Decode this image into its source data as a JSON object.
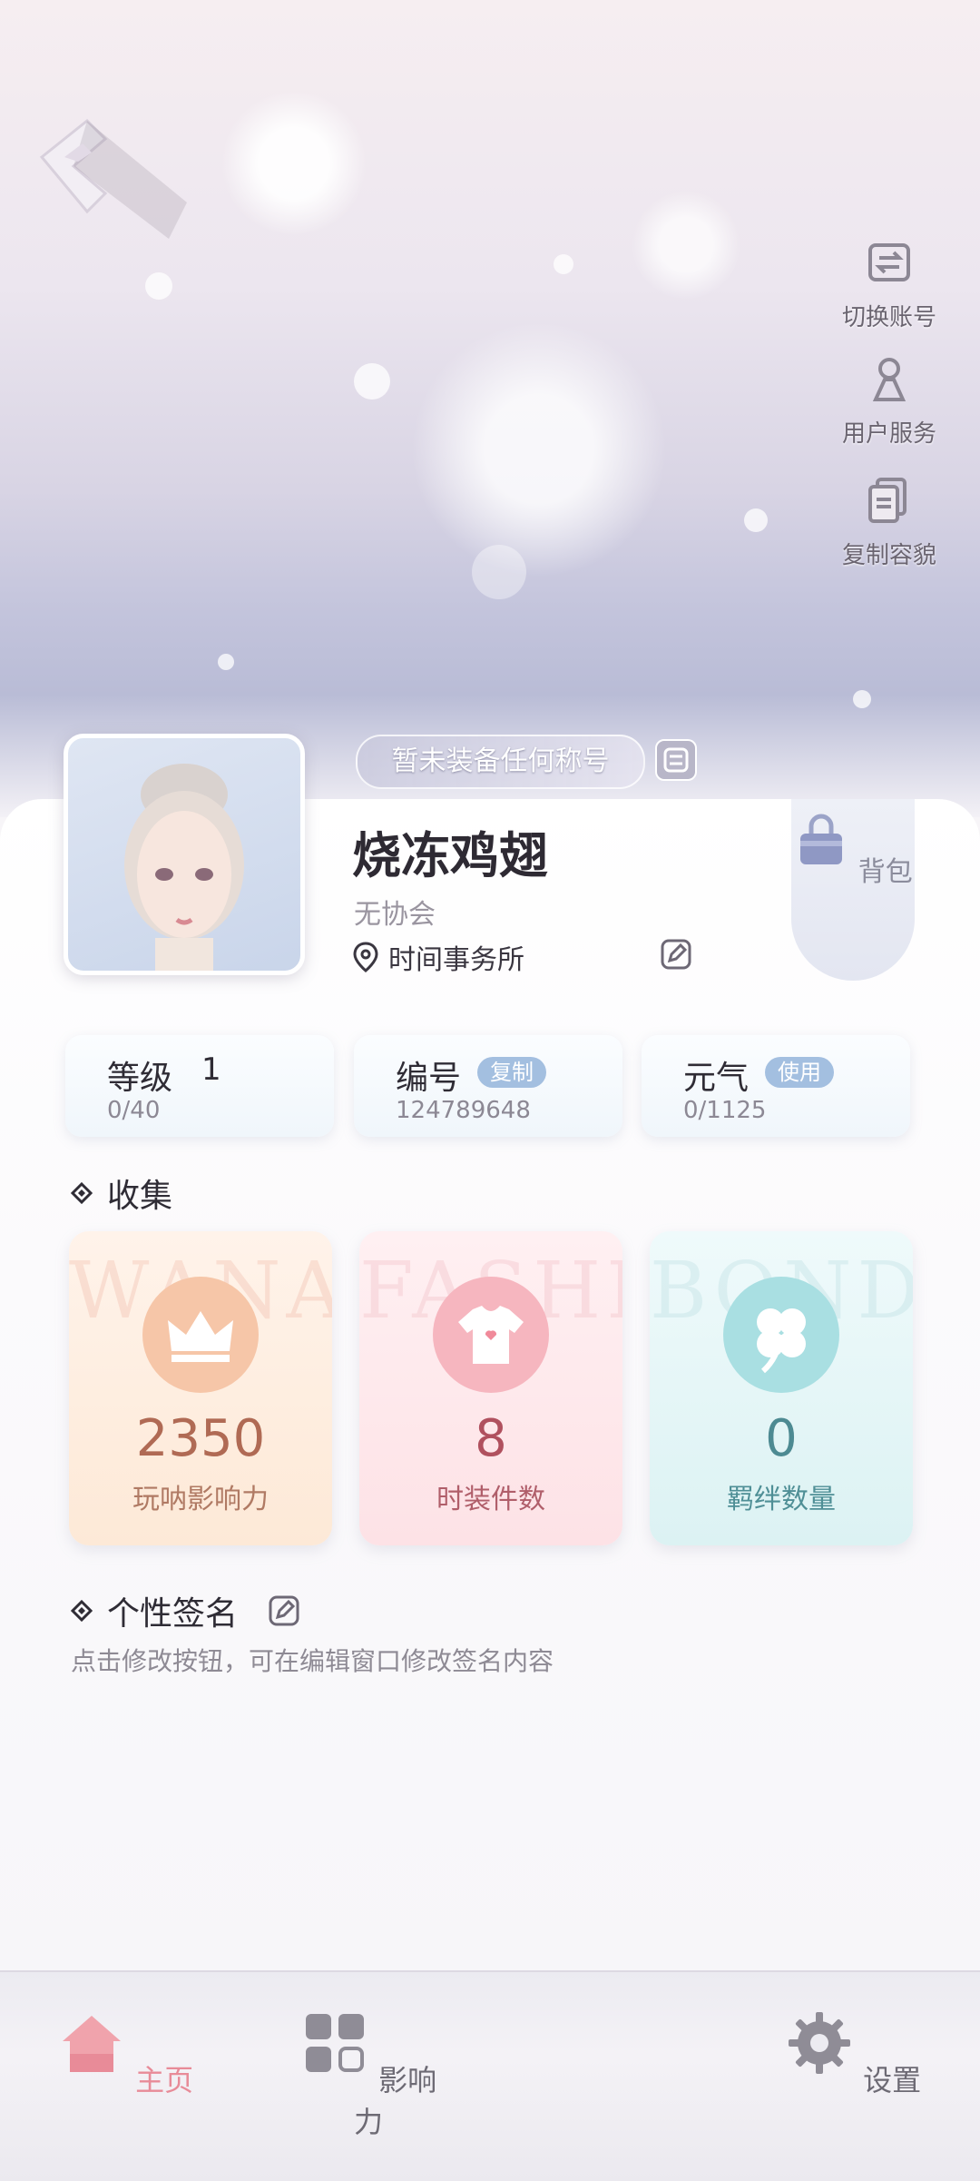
{
  "header": {
    "side_actions": [
      {
        "label": "切换账号",
        "icon": "switch-account-icon"
      },
      {
        "label": "用户服务",
        "icon": "user-service-icon"
      },
      {
        "label": "复制容貌",
        "icon": "copy-appearance-icon"
      }
    ]
  },
  "profile": {
    "title_text": "暂未装备任何称号",
    "name": "烧冻鸡翅",
    "guild": "无协会",
    "location": "时间事务所",
    "bag_label": "背包"
  },
  "stats": {
    "level": {
      "label": "等级",
      "value": "1",
      "progress": "0/40"
    },
    "id": {
      "label": "编号",
      "badge": "复制",
      "value": "124789648"
    },
    "energy": {
      "label": "元气",
      "badge": "使用",
      "value": "0/1125"
    }
  },
  "collection": {
    "title": "收集",
    "cards": [
      {
        "value": "2350",
        "label": "玩呐影响力",
        "watermark": "WANAN",
        "icon": "crown-icon"
      },
      {
        "value": "8",
        "label": "时装件数",
        "watermark": "FASHIO",
        "icon": "tshirt-icon"
      },
      {
        "value": "0",
        "label": "羁绊数量",
        "watermark": "BOND",
        "icon": "clover-icon"
      }
    ]
  },
  "signature": {
    "title": "个性签名",
    "hint": "点击修改按钮，可在编辑窗口修改签名内容"
  },
  "bottom_nav": {
    "items": [
      {
        "label": "主页",
        "icon": "home-icon",
        "active": true
      },
      {
        "label": "影响力",
        "icon": "grid-icon",
        "active": false
      },
      {
        "label": "设置",
        "icon": "gear-icon",
        "active": false
      }
    ]
  },
  "colors": {
    "accent_pink": "#e88b98",
    "badge_blue": "#a3bfe0",
    "influence_orange": "#b8735e",
    "fashion_red": "#b85e6a",
    "bond_teal": "#4f8f96"
  }
}
